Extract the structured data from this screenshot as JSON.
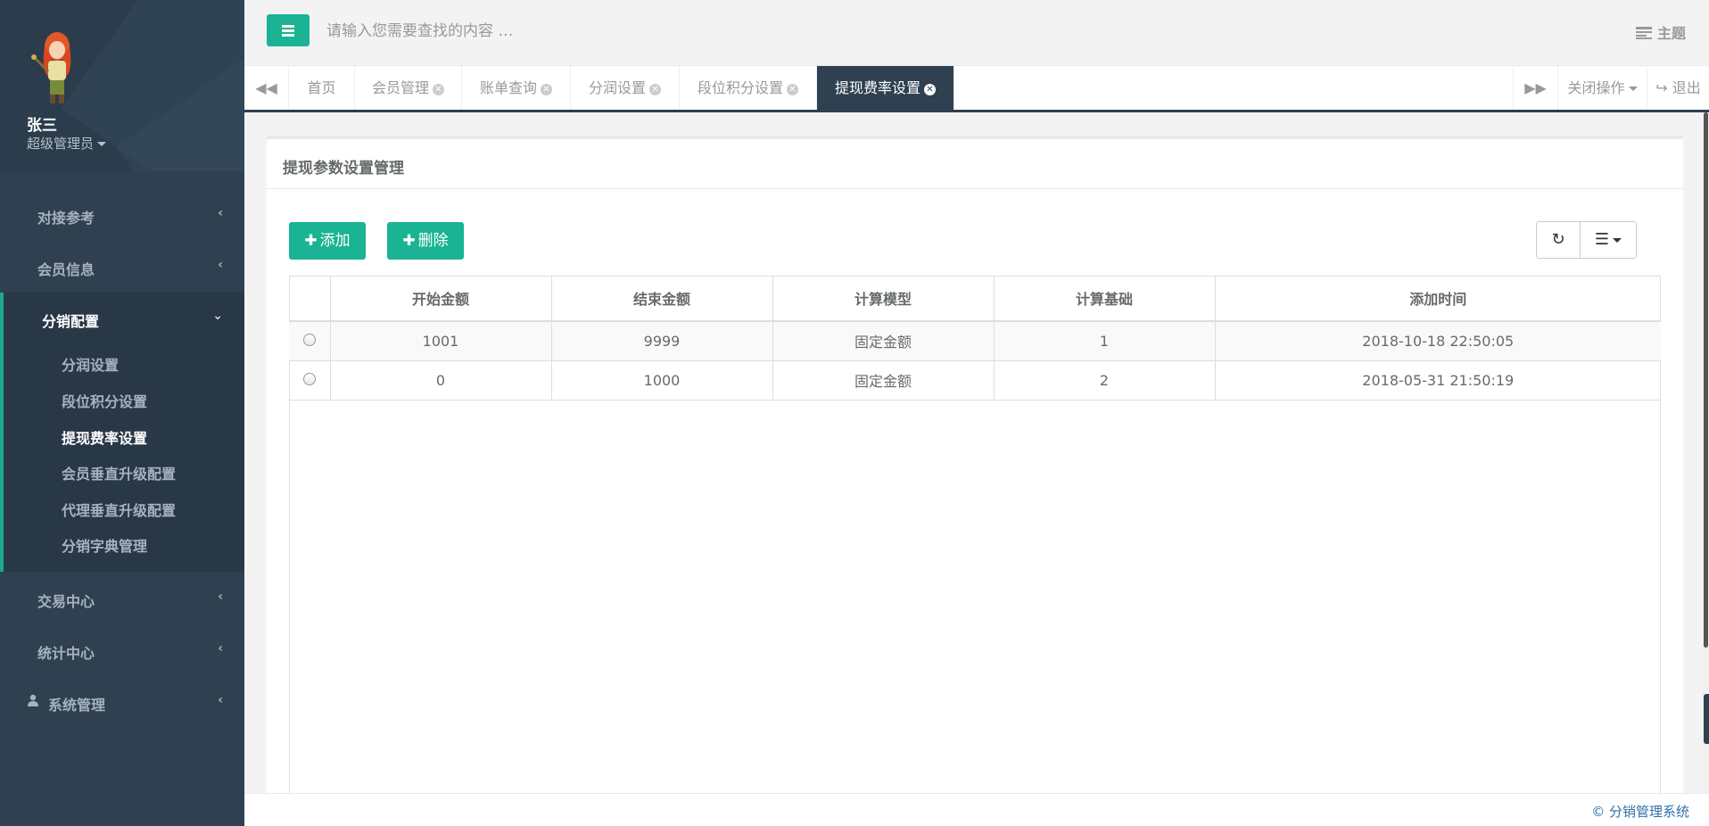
{
  "user": {
    "name": "张三",
    "role": "超级管理员"
  },
  "sidebar": {
    "items": [
      {
        "label": "对接参考"
      },
      {
        "label": "会员信息"
      },
      {
        "label": "分销配置"
      },
      {
        "label": "交易中心"
      },
      {
        "label": "统计中心"
      },
      {
        "label": "系统管理"
      }
    ],
    "sub_items": [
      {
        "label": "分润设置"
      },
      {
        "label": "段位积分设置"
      },
      {
        "label": "提现费率设置"
      },
      {
        "label": "会员垂直升级配置"
      },
      {
        "label": "代理垂直升级配置"
      },
      {
        "label": "分销字典管理"
      }
    ]
  },
  "topbar": {
    "search_placeholder": "请输入您需要查找的内容 …",
    "theme_label": "主题"
  },
  "tabs": {
    "items": [
      {
        "label": "首页"
      },
      {
        "label": "会员管理"
      },
      {
        "label": "账单查询"
      },
      {
        "label": "分润设置"
      },
      {
        "label": "段位积分设置"
      },
      {
        "label": "提现费率设置"
      }
    ],
    "close_ops": "关闭操作",
    "logout": "退出"
  },
  "panel": {
    "title": "提现参数设置管理",
    "add_label": "添加",
    "delete_label": "删除"
  },
  "table": {
    "headers": [
      "开始金额",
      "结束金额",
      "计算模型",
      "计算基础",
      "添加时间"
    ],
    "rows": [
      [
        "1001",
        "9999",
        "固定金额",
        "1",
        "2018-10-18 22:50:05"
      ],
      [
        "0",
        "1000",
        "固定金额",
        "2",
        "2018-05-31 21:50:19"
      ]
    ]
  },
  "footer": {
    "text": "© 分销管理系统"
  },
  "colors": {
    "accent": "#1ab394",
    "sidebar": "#2f4050",
    "sidebar_active": "#293846"
  }
}
